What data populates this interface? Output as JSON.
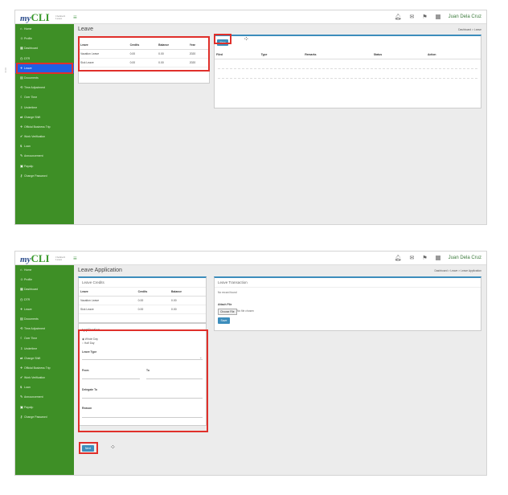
{
  "app": {
    "logo_my": "my",
    "logo_cli": "CLI",
    "logo_tag": "Chemtech Leases",
    "user": "Juan Dela Cruz"
  },
  "sidebar1": [
    "Home",
    "Profile",
    "Dashboard",
    "DTR",
    "Leave",
    "Documents",
    "Time Adjustment",
    "Over Time",
    "Undertime",
    "Change Shift",
    "Official Business Trip",
    "Work Verification",
    "Loan",
    "Announcement",
    "Payslip",
    "Change Password"
  ],
  "sidebar2": [
    "Home",
    "Profile",
    "Dashboard",
    "DTR",
    "Leave",
    "Documents",
    "Time Adjustment",
    "Over Time",
    "Undertime",
    "Change Shift",
    "Official Business Trip",
    "Work Verification",
    "Loan",
    "Announcement",
    "Payslip",
    "Change Password"
  ],
  "screen1": {
    "title": "Leave",
    "crumb_home": "Dashboard",
    "crumb_sep": ">",
    "crumb_current": "Leave",
    "credits_headers": [
      "Leave",
      "Credits",
      "Balance",
      "Year"
    ],
    "credits_rows": [
      [
        "Vacation Leave",
        "0.00",
        "0.00",
        "2020"
      ],
      [
        "Sick Leave",
        "0.00",
        "0.00",
        "2020"
      ]
    ],
    "new_button": "New",
    "tx_headers": [
      "Filed",
      "Type",
      "Remarks",
      "Status",
      "Action"
    ]
  },
  "screen2": {
    "title": "Leave Application",
    "crumb_home": "Dashboard",
    "crumb_sep": ">",
    "crumb_mid": "Leave",
    "crumb_current": "Leave Application",
    "credits_title": "Leave Credits",
    "credits_headers": [
      "Leave",
      "Credits",
      "Balance"
    ],
    "credits_rows": [
      [
        "Vacation Leave",
        "0.00",
        "0.00"
      ],
      [
        "Sick Leave",
        "0.00",
        "0.00"
      ]
    ],
    "application_title": "Application",
    "radio_whole": "Whole Day",
    "radio_half": "Half Day",
    "leave_type_label": "Leave Type",
    "from_label": "From",
    "to_label": "To",
    "delegate_label": "Delegate To",
    "reason_label": "Reason",
    "next_button": "Next",
    "tx_title": "Leave Transaction",
    "tx_empty": "No record found",
    "attach_label": "Attach File",
    "choose_button": "Choose File",
    "no_file": "No file chosen",
    "save_button": "Save"
  }
}
